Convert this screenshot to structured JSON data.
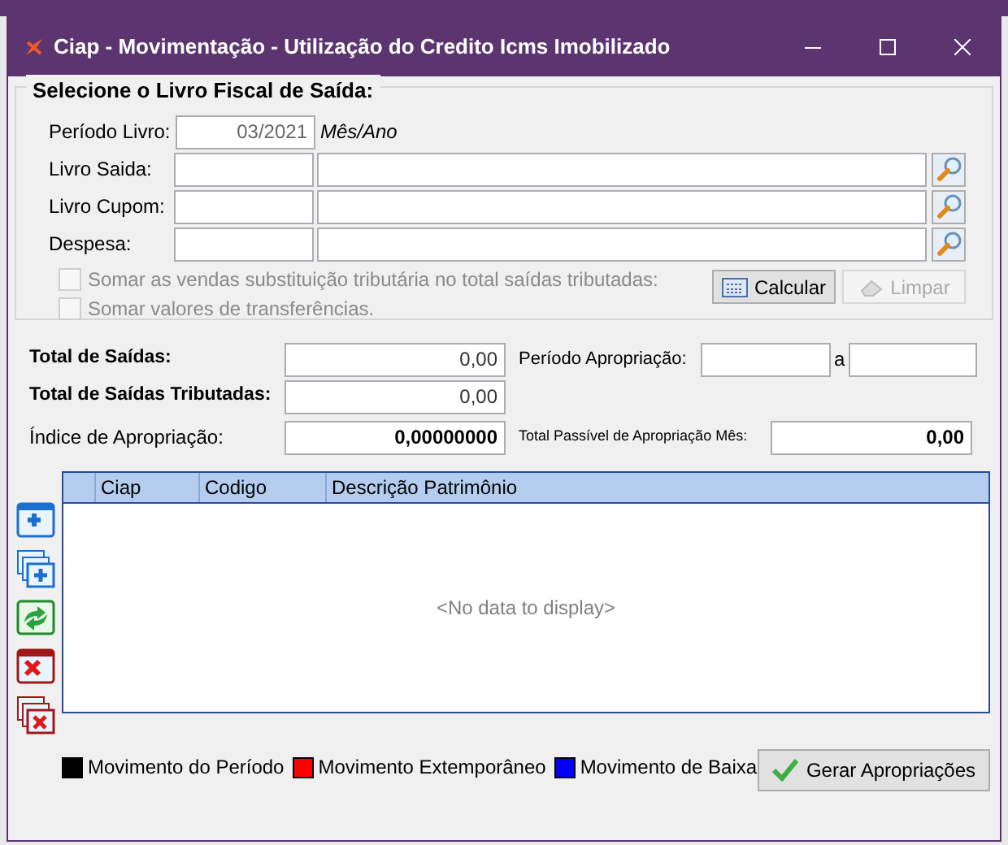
{
  "window": {
    "title": "Ciap - Movimentação - Utilização do Credito Icms Imobilizado"
  },
  "group": {
    "title": "Selecione o Livro Fiscal de Saída:",
    "periodo": {
      "label": "Período Livro:",
      "value": "03/2021",
      "hint": "Mês/Ano"
    },
    "lookups": [
      {
        "label": "Livro Saida:"
      },
      {
        "label": "Livro Cupom:"
      },
      {
        "label": "Despesa:"
      }
    ],
    "options": [
      {
        "label": "Somar as vendas substituição tributária no total saídas tributadas:",
        "checked": false,
        "disabled": true
      },
      {
        "label": "Somar valores de transferências.",
        "checked": false,
        "disabled": true
      }
    ],
    "buttons": [
      {
        "kind": "calc",
        "label": "Calcular",
        "disabled": false
      },
      {
        "kind": "clear",
        "label": "Limpar",
        "disabled": true
      }
    ]
  },
  "totals": {
    "total_saidas": {
      "label": "Total de Saídas:",
      "value": "0,00"
    },
    "total_tributadas": {
      "label": "Total de Saídas Tributadas:",
      "value": "0,00"
    },
    "indice": {
      "label": "Índice de Apropriação:",
      "value": "0,00000000"
    },
    "periodo_apropriacao": {
      "label": "Período Apropriação:",
      "separator": "a"
    },
    "total_passivel": {
      "label": "Total Passível de Apropriação Mês:",
      "value": "0,00"
    }
  },
  "toolbar": [
    {
      "kind": "add"
    },
    {
      "kind": "add-multi"
    },
    {
      "kind": "refresh"
    },
    {
      "kind": "delete"
    },
    {
      "kind": "delete-multi"
    }
  ],
  "table": {
    "columns": [
      "Ciap",
      "Codigo",
      "Descrição Patrimônio"
    ],
    "empty_text": "<No data to display>"
  },
  "legend": [
    {
      "label": "Movimento do Período",
      "color": "#000000"
    },
    {
      "label": "Movimento Extemporâneo",
      "color": "#ff0000"
    },
    {
      "label": "Movimento de Baixa",
      "color": "#0000ff"
    }
  ],
  "action": {
    "label": "Gerar Apropriações"
  }
}
